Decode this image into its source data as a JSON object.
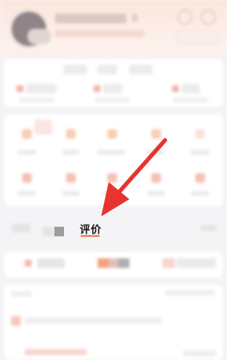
{
  "screen": {
    "tab_label": "评价",
    "annotation": {
      "color": "#e8342e",
      "underline_color": "#f18a6d"
    }
  },
  "icons": {
    "avatar": "avatar-icon",
    "header_icon_1": "headset-icon",
    "header_icon_2": "settings-icon",
    "pointer": "red-arrow-icon"
  }
}
